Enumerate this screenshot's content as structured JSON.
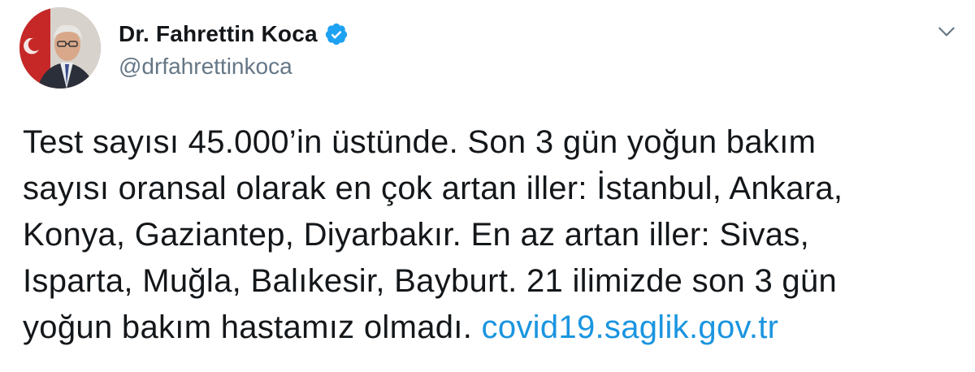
{
  "author": {
    "display_name": "Dr. Fahrettin Koca",
    "handle": "@drfahrettinkoca",
    "verified": true
  },
  "tweet": {
    "lines": [
      "Test sayısı 45.000’in üstünde. Son 3 gün yoğun bakım",
      "sayısı oransal olarak en çok artan iller: İstanbul, Ankara,",
      "Konya, Gaziantep, Diyarbakır. En az artan iller: Sivas,",
      "Isparta, Muğla, Balıkesir, Bayburt. 21 ilimizde son 3 gün",
      "yoğun bakım hastamız olmadı."
    ],
    "link_text": "covid19.saglik.gov.tr"
  },
  "icons": {
    "verified": "verified-badge-icon",
    "caret": "chevron-down-icon"
  },
  "colors": {
    "text": "#14171a",
    "secondary": "#657786",
    "link": "#1b95e0",
    "verified": "#1da1f2"
  }
}
